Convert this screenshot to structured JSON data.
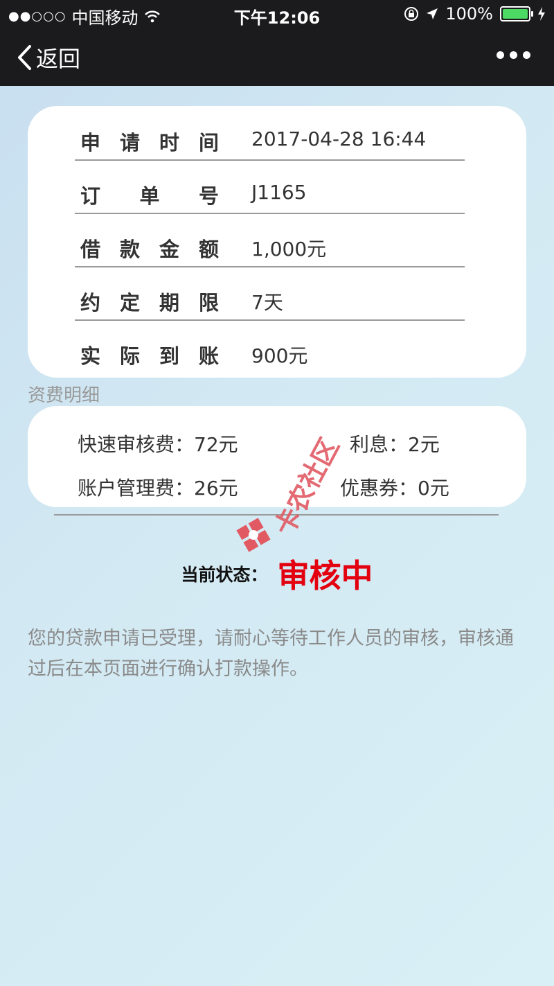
{
  "status_bar": {
    "carrier": "中国移动",
    "time": "下午12:06",
    "battery": "100%"
  },
  "nav": {
    "back_label": "返回"
  },
  "details": [
    {
      "label": [
        "申",
        "请",
        "时",
        "间"
      ],
      "value": "2017-04-28 16:44"
    },
    {
      "label": [
        "订",
        "单",
        "号"
      ],
      "value": "J1165"
    },
    {
      "label": [
        "借",
        "款",
        "金",
        "额"
      ],
      "value": "1,000元"
    },
    {
      "label": [
        "约",
        "定",
        "期",
        "限"
      ],
      "value": "7天"
    },
    {
      "label": [
        "实",
        "际",
        "到",
        "账"
      ],
      "value": "900元"
    }
  ],
  "fees": {
    "title": "资费明细",
    "quick_review": "快速审核费：72元",
    "interest": "利息：2元",
    "account_mgmt": "账户管理费：26元",
    "coupon": "优惠券：0元"
  },
  "current_status": {
    "label": "当前状态：",
    "value": "审核中"
  },
  "description": "您的贷款申请已受理，请耐心等待工作人员的审核，审核通过后在本页面进行确认打款操作。",
  "watermark": "卡农社区",
  "colors": {
    "status_red": "#e3000f",
    "battery_green": "#4cd964",
    "nav_bg": "#1b1b1d"
  }
}
